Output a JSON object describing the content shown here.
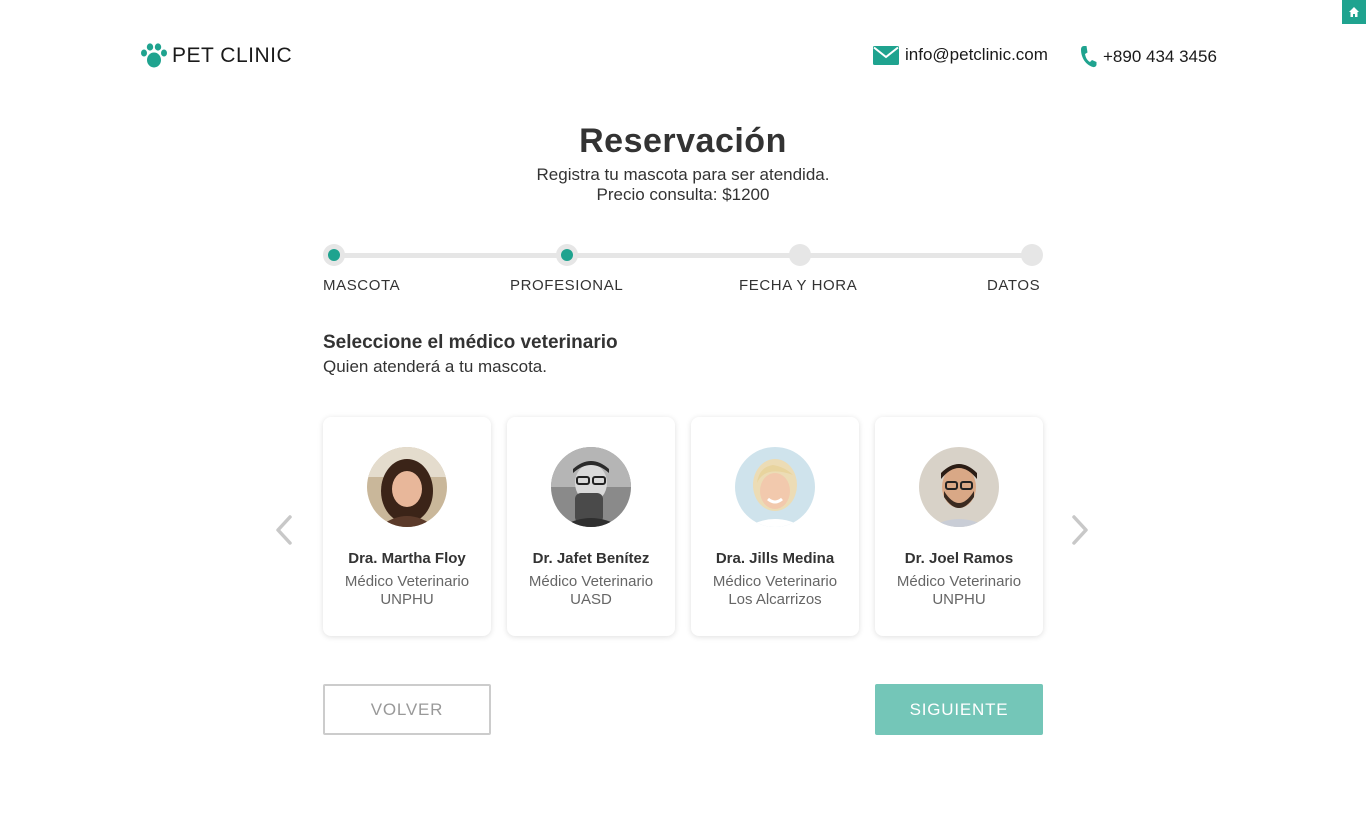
{
  "header": {
    "brand": "PET CLINIC",
    "email": "info@petclinic.com",
    "phone": "+890 434 3456"
  },
  "page": {
    "title": "Reservación",
    "subtitle_line1": "Registra tu mascota para ser atendida.",
    "subtitle_line2": "Precio consulta: $1200"
  },
  "stepper": {
    "steps": [
      {
        "label": "MASCOTA",
        "state": "done"
      },
      {
        "label": "PROFESIONAL",
        "state": "current"
      },
      {
        "label": "FECHA Y HORA",
        "state": "pending"
      },
      {
        "label": "DATOS",
        "state": "pending"
      }
    ]
  },
  "section": {
    "title": "Seleccione el médico veterinario",
    "subtitle": "Quien atenderá a tu mascota."
  },
  "doctors": [
    {
      "name": "Dra. Martha Floy",
      "role": "Médico Veterinario",
      "school": "UNPHU"
    },
    {
      "name": "Dr. Jafet Benítez",
      "role": "Médico Veterinario",
      "school": "UASD"
    },
    {
      "name": "Dra. Jills Medina",
      "role": "Médico Veterinario",
      "school": "Los Alcarrizos"
    },
    {
      "name": "Dr. Joel Ramos",
      "role": "Médico Veterinario",
      "school": "UNPHU"
    }
  ],
  "buttons": {
    "back": "VOLVER",
    "next": "SIGUIENTE"
  },
  "colors": {
    "accent": "#1fa38f",
    "button_next": "#74c6b8",
    "track": "#e6e6e6"
  },
  "icons": {
    "corner": "home-icon",
    "logo": "paw-icon",
    "email": "envelope-icon",
    "phone": "phone-icon",
    "prev": "chevron-left-icon",
    "next": "chevron-right-icon"
  }
}
